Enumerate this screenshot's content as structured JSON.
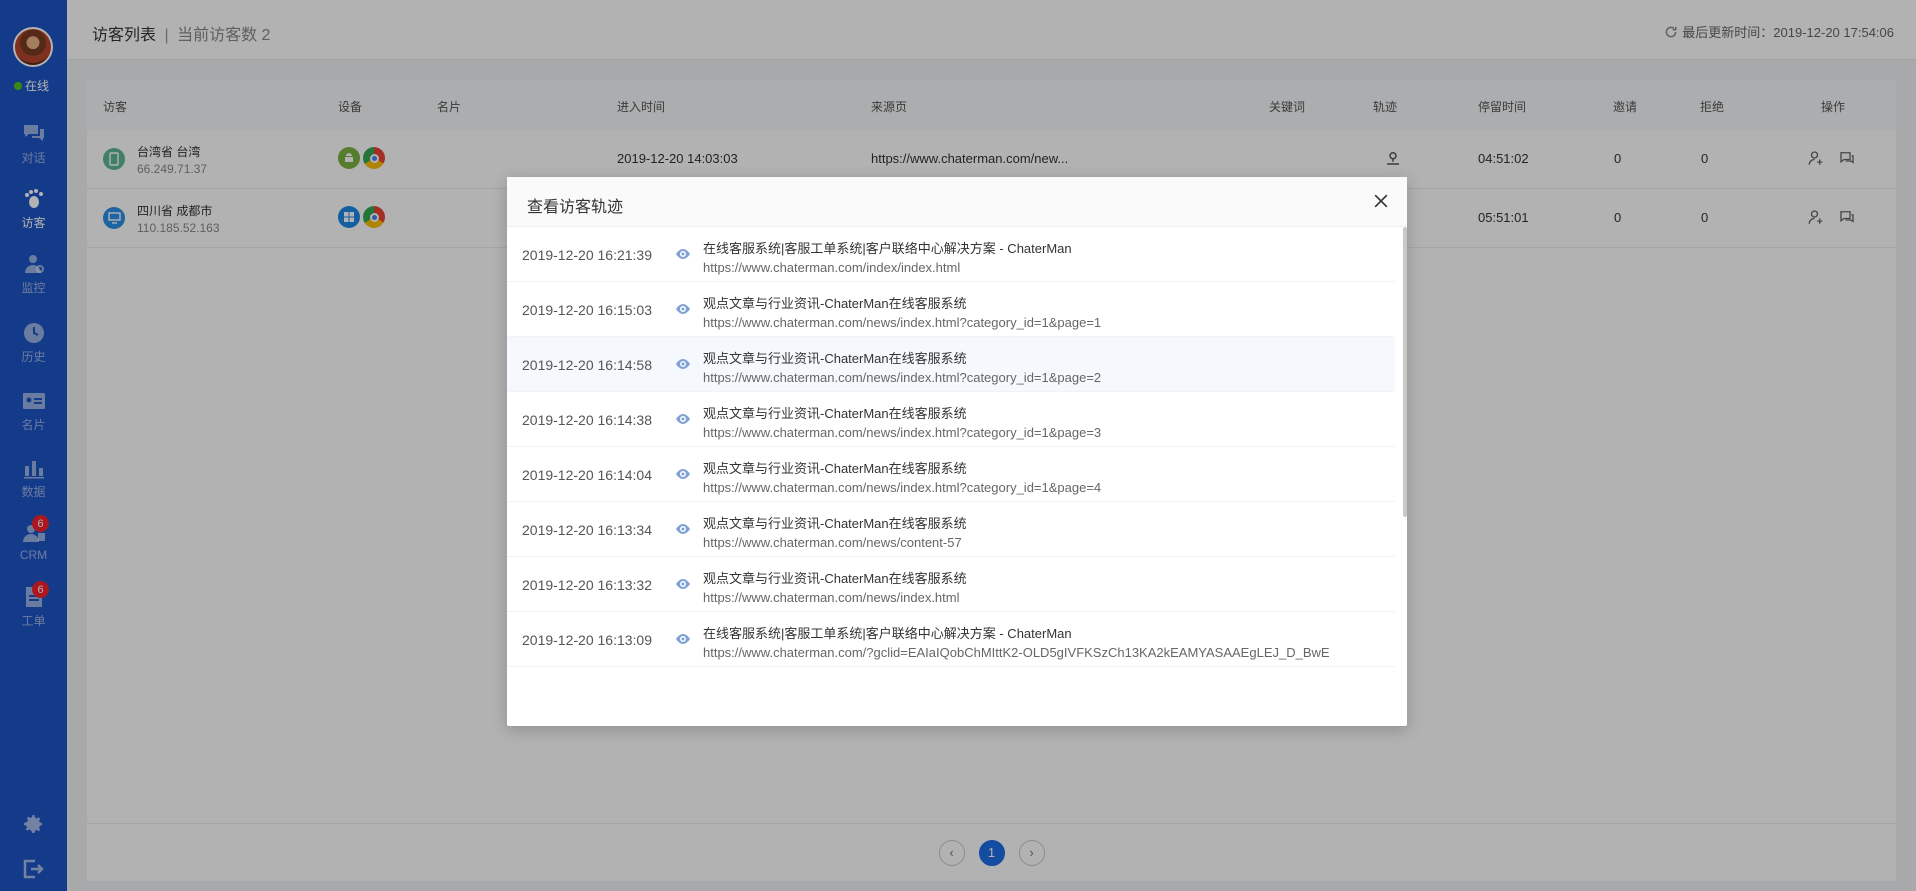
{
  "sidebar": {
    "status": "在线",
    "items": [
      {
        "label": "对话",
        "icon": "chat-icon",
        "active": false
      },
      {
        "label": "访客",
        "icon": "footprint-icon",
        "active": true
      },
      {
        "label": "监控",
        "icon": "monitor-icon",
        "active": false
      },
      {
        "label": "历史",
        "icon": "history-icon",
        "active": false
      },
      {
        "label": "名片",
        "icon": "card-icon",
        "active": false
      },
      {
        "label": "数据",
        "icon": "data-icon",
        "active": false
      },
      {
        "label": "CRM",
        "icon": "crm-icon",
        "active": false,
        "badge": "6"
      },
      {
        "label": "工单",
        "icon": "ticket-icon",
        "active": false,
        "badge": "6"
      }
    ],
    "bottom_icons": [
      "settings-icon",
      "logout-icon"
    ]
  },
  "header": {
    "title": "访客列表",
    "separator": "|",
    "subtitle": "当前访客数 2",
    "last_update": "最后更新时间：2019-12-20 17:54:06"
  },
  "table": {
    "columns": [
      "访客",
      "设备",
      "名片",
      "进入时间",
      "来源页",
      "关键词",
      "轨迹",
      "停留时间",
      "邀请",
      "拒绝",
      "操作"
    ],
    "rows": [
      {
        "location": "台湾省 台湾",
        "ip": "66.249.71.37",
        "device": "mobile",
        "os": "android",
        "browser": "chrome",
        "card": "",
        "enter_time": "2019-12-20 14:03:03",
        "source": "https://www.chaterman.com/new...",
        "keyword": "",
        "stay": "04:51:02",
        "invite": "0",
        "reject": "0"
      },
      {
        "location": "四川省 成都市",
        "ip": "110.185.52.163",
        "device": "desktop",
        "os": "windows",
        "browser": "chrome",
        "card": "",
        "enter_time": "",
        "source": "",
        "keyword": "",
        "stay": "05:51:01",
        "invite": "0",
        "reject": "0"
      }
    ],
    "pagination": {
      "prev": "‹",
      "current": "1",
      "next": "›"
    }
  },
  "modal": {
    "title": "查看访客轨迹",
    "items": [
      {
        "time": "2019-12-20 16:21:39",
        "title": "在线客服系统|客服工单系统|客户联络中心解决方案 - ChaterMan",
        "url": "https://www.chaterman.com/index/index.html"
      },
      {
        "time": "2019-12-20 16:15:03",
        "title": "观点文章与行业资讯-ChaterMan在线客服系统",
        "url": "https://www.chaterman.com/news/index.html?category_id=1&page=1"
      },
      {
        "time": "2019-12-20 16:14:58",
        "title": "观点文章与行业资讯-ChaterMan在线客服系统",
        "url": "https://www.chaterman.com/news/index.html?category_id=1&page=2"
      },
      {
        "time": "2019-12-20 16:14:38",
        "title": "观点文章与行业资讯-ChaterMan在线客服系统",
        "url": "https://www.chaterman.com/news/index.html?category_id=1&page=3"
      },
      {
        "time": "2019-12-20 16:14:04",
        "title": "观点文章与行业资讯-ChaterMan在线客服系统",
        "url": "https://www.chaterman.com/news/index.html?category_id=1&page=4"
      },
      {
        "time": "2019-12-20 16:13:34",
        "title": "观点文章与行业资讯-ChaterMan在线客服系统",
        "url": "https://www.chaterman.com/news/content-57"
      },
      {
        "time": "2019-12-20 16:13:32",
        "title": "观点文章与行业资讯-ChaterMan在线客服系统",
        "url": "https://www.chaterman.com/news/index.html"
      },
      {
        "time": "2019-12-20 16:13:09",
        "title": "在线客服系统|客服工单系统|客户联络中心解决方案 - ChaterMan",
        "url": "https://www.chaterman.com/?gclid=EAIaIQobChMIttK2-OLD5gIVFKSzCh13KA2kEAMYASAAEgLEJ_D_BwE"
      }
    ]
  },
  "colors": {
    "sidebar": "#1e54c6",
    "accent": "#1e6ee8",
    "online": "#52c41a",
    "badge": "#f5222d"
  }
}
